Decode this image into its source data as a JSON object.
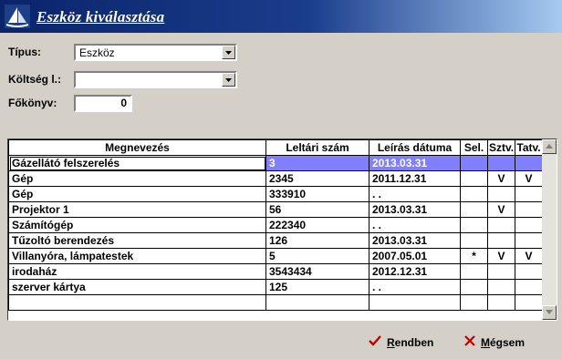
{
  "window": {
    "title": "Eszköz kiválasztása"
  },
  "form": {
    "tipus_label": "Típus:",
    "tipus_value": "Eszköz",
    "koltseg_label": "Költség l.:",
    "koltseg_value": "",
    "fokonyv_label": "Főkönyv:",
    "fokonyv_value": "0"
  },
  "table": {
    "headers": [
      "Megnevezés",
      "Leltári szám",
      "Leírás dátuma",
      "Sel.",
      "Sztv.",
      "Tatv."
    ],
    "rows": [
      [
        "Gázellátó felszerelés",
        "3",
        "2013.03.31",
        "",
        "",
        ""
      ],
      [
        "Gép",
        "2345",
        "2011.12.31",
        "",
        "V",
        "V"
      ],
      [
        "Gép",
        "333910",
        ".  .",
        "",
        "",
        ""
      ],
      [
        "Projektor 1",
        "56",
        "2013.03.31",
        "",
        "V",
        ""
      ],
      [
        "Számítógép",
        "222340",
        ".  .",
        "",
        "",
        ""
      ],
      [
        "Tűzoltó berendezés",
        "126",
        "2013.03.31",
        "",
        "",
        ""
      ],
      [
        "Villanyóra, lámpatestek",
        "5",
        "2007.05.01",
        "*",
        "V",
        "V"
      ],
      [
        "irodaház",
        "3543434",
        "2012.12.31",
        "",
        "",
        ""
      ],
      [
        "szerver kártya",
        "125",
        ".  .",
        "",
        "",
        ""
      ],
      [
        "",
        "",
        "",
        "",
        "",
        ""
      ]
    ]
  },
  "buttons": {
    "ok_first": "R",
    "ok_rest": "endben",
    "cancel_first": "M",
    "cancel_rest": "égsem"
  },
  "colors": {
    "title_bar": "#0a246a",
    "selection": "#8080ff",
    "ok_check": "#c00000",
    "cancel_x": "#c00000"
  }
}
